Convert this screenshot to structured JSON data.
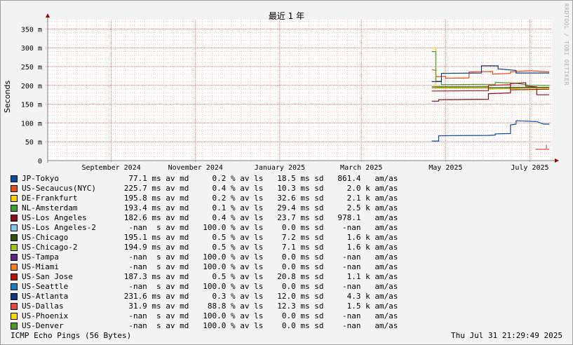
{
  "chart_data": {
    "type": "line",
    "title": "最近 1 年",
    "ylabel": "Seconds",
    "watermark": "RRDTOOL / TOBI OETIKER",
    "ylim": [
      0,
      0.375
    ],
    "y_ticks": [
      {
        "value": 0,
        "label": "0"
      },
      {
        "value": 0.05,
        "label": "50 m"
      },
      {
        "value": 0.1,
        "label": "100 m"
      },
      {
        "value": 0.15,
        "label": "150 m"
      },
      {
        "value": 0.2,
        "label": "200 m"
      },
      {
        "value": 0.25,
        "label": "250 m"
      },
      {
        "value": 0.3,
        "label": "300 m"
      },
      {
        "value": 0.35,
        "label": "350 m"
      }
    ],
    "xlim": [
      "2024-07-31",
      "2025-07-31"
    ],
    "x_ticks": [
      {
        "value": "2024-09-15",
        "label": "September 2024"
      },
      {
        "value": "2024-11-15",
        "label": "November 2024"
      },
      {
        "value": "2025-01-15",
        "label": "January 2025"
      },
      {
        "value": "2025-03-15",
        "label": "March 2025"
      },
      {
        "value": "2025-05-15",
        "label": "May 2025"
      },
      {
        "value": "2025-07-15",
        "label": "July 2025"
      }
    ],
    "grid": true,
    "legend_placement": "bottom",
    "series": [
      {
        "name": "JP-Tokyo",
        "color": "#0b4da2",
        "line": "JP-Tokyo               77.1 ms av md     0.2 % av ls   18.5 ms sd   861.4   am/as",
        "points": [
          [
            "2025-05-05",
            0.052
          ],
          [
            "2025-05-10",
            0.052
          ],
          [
            "2025-05-10",
            0.066
          ],
          [
            "2025-06-15",
            0.067
          ],
          [
            "2025-06-20",
            0.068
          ],
          [
            "2025-06-20",
            0.071
          ],
          [
            "2025-07-01",
            0.072
          ],
          [
            "2025-07-01",
            0.095
          ],
          [
            "2025-07-05",
            0.097
          ],
          [
            "2025-07-05",
            0.106
          ],
          [
            "2025-07-20",
            0.104
          ],
          [
            "2025-07-25",
            0.097
          ],
          [
            "2025-07-29",
            0.097
          ]
        ]
      },
      {
        "name": "US-Secaucus(NYC)",
        "color": "#ec4b1a",
        "line": "US-Secaucus(NYC)      225.7 ms av md     0.4 % av ls   10.3 ms sd     2.0 k am/as",
        "points": [
          [
            "2025-05-05",
            0.242
          ],
          [
            "2025-05-08",
            0.24
          ],
          [
            "2025-05-08",
            0.223
          ],
          [
            "2025-05-15",
            0.224
          ],
          [
            "2025-05-15",
            0.219
          ],
          [
            "2025-06-01",
            0.22
          ],
          [
            "2025-06-01",
            0.236
          ],
          [
            "2025-06-18",
            0.237
          ],
          [
            "2025-06-18",
            0.23
          ],
          [
            "2025-07-01",
            0.232
          ],
          [
            "2025-07-01",
            0.236
          ],
          [
            "2025-07-15",
            0.239
          ],
          [
            "2025-07-29",
            0.236
          ]
        ]
      },
      {
        "name": "DE-Frankfurt",
        "color": "#f8d200",
        "line": "DE-Frankfurt          195.8 ms av md     0.2 % av ls   32.6 ms sd     2.1 k am/as",
        "points": [
          [
            "2025-05-05",
            0.3
          ],
          [
            "2025-05-08",
            0.3
          ],
          [
            "2025-05-08",
            0.195
          ],
          [
            "2025-06-15",
            0.196
          ],
          [
            "2025-06-15",
            0.19
          ],
          [
            "2025-07-01",
            0.192
          ],
          [
            "2025-07-10",
            0.188
          ],
          [
            "2025-07-29",
            0.19
          ]
        ]
      },
      {
        "name": "NL-Amsterdam",
        "color": "#3fa02f",
        "line": "NL-Amsterdam          193.4 ms av md     0.1 % av ls   29.4 ms sd     2.5 k am/as",
        "points": [
          [
            "2025-05-05",
            0.29
          ],
          [
            "2025-05-08",
            0.29
          ],
          [
            "2025-05-08",
            0.211
          ],
          [
            "2025-05-12",
            0.211
          ],
          [
            "2025-05-12",
            0.202
          ],
          [
            "2025-06-20",
            0.203
          ],
          [
            "2025-06-20",
            0.208
          ],
          [
            "2025-07-05",
            0.206
          ],
          [
            "2025-07-15",
            0.2
          ],
          [
            "2025-07-29",
            0.2
          ]
        ]
      },
      {
        "name": "US-Los Angeles",
        "color": "#8b0f1a",
        "line": "US-Los Angeles        182.6 ms av md     0.4 % av ls   23.7 ms sd   978.1   am/as",
        "points": [
          [
            "2025-05-05",
            0.158
          ],
          [
            "2025-05-10",
            0.158
          ],
          [
            "2025-05-10",
            0.162
          ],
          [
            "2025-06-15",
            0.163
          ],
          [
            "2025-06-15",
            0.178
          ],
          [
            "2025-07-01",
            0.18
          ],
          [
            "2025-07-01",
            0.205
          ],
          [
            "2025-07-12",
            0.207
          ],
          [
            "2025-07-12",
            0.198
          ],
          [
            "2025-07-20",
            0.196
          ],
          [
            "2025-07-20",
            0.175
          ],
          [
            "2025-07-29",
            0.175
          ]
        ]
      },
      {
        "name": "US-Los Angeles-2",
        "color": "#82c8ef",
        "line": "US-Los Angeles-2       -nan  s av md   100.0 % av ls    0.0 ms sd    -nan   am/as",
        "points": []
      },
      {
        "name": "US-Chicago",
        "color": "#3a4d10",
        "line": "US-Chicago            195.1 ms av md     0.5 % av ls    7.2 ms sd     1.6 k am/as",
        "points": [
          [
            "2025-05-05",
            0.196
          ],
          [
            "2025-06-15",
            0.196
          ],
          [
            "2025-06-15",
            0.194
          ],
          [
            "2025-07-29",
            0.195
          ]
        ]
      },
      {
        "name": "US-Chicago-2",
        "color": "#a4c316",
        "line": "US-Chicago-2          194.9 ms av md     0.5 % av ls    7.1 ms sd     1.6 k am/as",
        "points": [
          [
            "2025-05-05",
            0.193
          ],
          [
            "2025-06-15",
            0.193
          ],
          [
            "2025-06-15",
            0.191
          ],
          [
            "2025-07-29",
            0.193
          ]
        ]
      },
      {
        "name": "US-Tampa",
        "color": "#5b2a84",
        "line": "US-Tampa               -nan  s av md   100.0 % av ls    0.0 ms sd    -nan   am/as",
        "points": []
      },
      {
        "name": "US-Miami",
        "color": "#f5841f",
        "line": "US-Miami               -nan  s av md   100.0 % av ls    0.0 ms sd    -nan   am/as",
        "points": []
      },
      {
        "name": "US-San Jose",
        "color": "#b41016",
        "line": "US-San Jose           187.3 ms av md     0.5 % av ls   20.8 ms sd     1.1 k am/as",
        "points": [
          [
            "2025-05-05",
            0.185
          ],
          [
            "2025-06-15",
            0.186
          ],
          [
            "2025-06-15",
            0.2
          ],
          [
            "2025-07-01",
            0.202
          ],
          [
            "2025-07-01",
            0.188
          ],
          [
            "2025-07-29",
            0.19
          ]
        ]
      },
      {
        "name": "US-Seattle",
        "color": "#1d7fc2",
        "line": "US-Seattle             -nan  s av md   100.0 % av ls    0.0 ms sd    -nan   am/as",
        "points": []
      },
      {
        "name": "US-Atlanta",
        "color": "#0e3b7d",
        "line": "US-Atlanta            231.6 ms av md     0.3 % av ls   12.0 ms sd     4.3 k am/as",
        "points": [
          [
            "2025-05-05",
            0.21
          ],
          [
            "2025-05-12",
            0.21
          ],
          [
            "2025-05-12",
            0.232
          ],
          [
            "2025-06-10",
            0.233
          ],
          [
            "2025-06-10",
            0.252
          ],
          [
            "2025-06-22",
            0.252
          ],
          [
            "2025-06-22",
            0.244
          ],
          [
            "2025-07-05",
            0.24
          ],
          [
            "2025-07-05",
            0.233
          ],
          [
            "2025-07-29",
            0.233
          ]
        ]
      },
      {
        "name": "US-Dallas",
        "color": "#e24a3f",
        "line": "US-Dallas              31.9 ms av md    88.8 % av ls   12.3 ms sd     1.5 k am/as",
        "points": [
          [
            "2025-07-19",
            0.03
          ],
          [
            "2025-07-27",
            0.03
          ],
          [
            "2025-07-27",
            0.042
          ],
          [
            "2025-07-27",
            0.03
          ],
          [
            "2025-07-29",
            0.03
          ]
        ]
      },
      {
        "name": "US-Phoenix",
        "color": "#f8da00",
        "line": "US-Phoenix             -nan  s av md   100.0 % av ls    0.0 ms sd    -nan   am/as",
        "points": []
      },
      {
        "name": "US-Denver",
        "color": "#4a9a25",
        "line": "US-Denver              -nan  s av md   100.0 % av ls    0.0 ms sd    -nan   am/as",
        "points": []
      }
    ]
  },
  "footer": {
    "left": "ICMP Echo Pings (56 Bytes)",
    "right": "Thu Jul 31 21:29:49 2025"
  }
}
